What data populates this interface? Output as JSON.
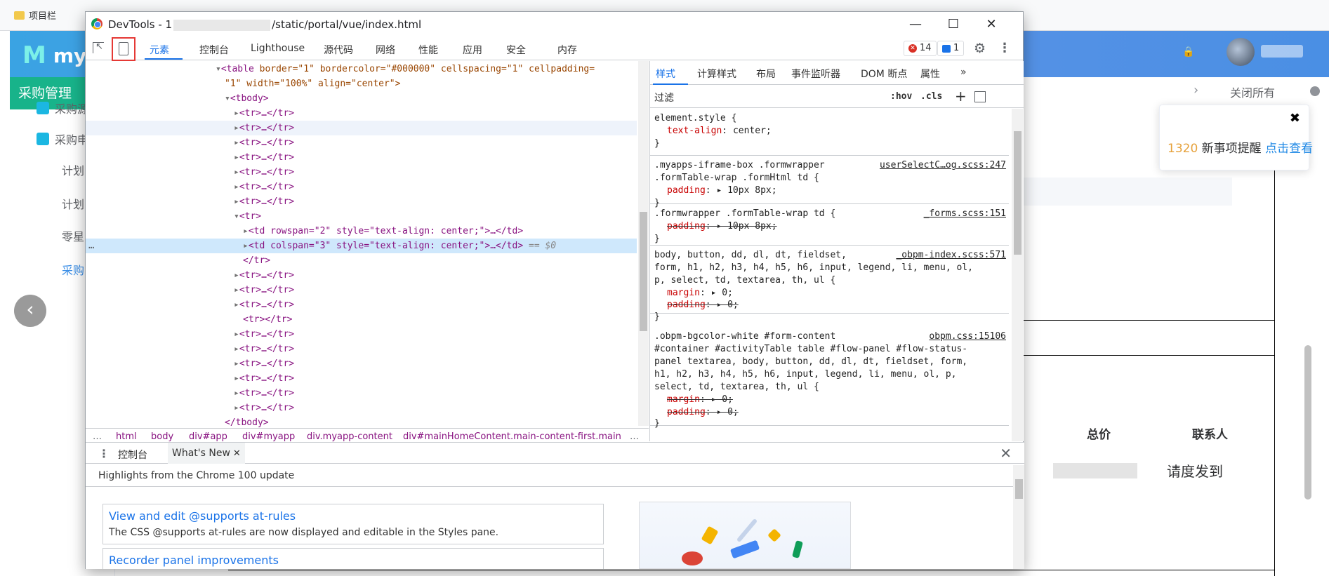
{
  "bookmarks": {
    "item": "项目栏"
  },
  "app": {
    "logo_text": "myA",
    "sidebar_title": "采购管理",
    "sidebar_items": [
      "采购源",
      "采购申"
    ],
    "sidebar_subitems": [
      "计划",
      "计划",
      "零星",
      "采购"
    ],
    "close_all": "关闭所有",
    "notification": {
      "count": "1320",
      "text": "新事项提醒",
      "link": "点击查看"
    },
    "table_headers": {
      "total": "总价",
      "contact": "联系人"
    },
    "cell_text": "请度发到"
  },
  "devtools": {
    "title_prefix": "DevTools - 1",
    "title_suffix": "/static/portal/vue/index.html",
    "window_buttons": {
      "minimize": "—",
      "maximize": "☐",
      "close": "✕"
    },
    "tabs": [
      "元素",
      "控制台",
      "Lighthouse",
      "源代码",
      "网络",
      "性能",
      "应用",
      "安全",
      "内存"
    ],
    "errors_count": "14",
    "issues_count": "1",
    "dom": {
      "table_open": "<table",
      "table_attrs_1": " border=\"1\" bordercolor=\"#000000\" cellspacing=\"1\" cellpadding=",
      "table_attrs_2": "\"1\" width=\"100%\" align=\"center\">",
      "tbody": "<tbody>",
      "tr_collapsed": "<tr>…</tr>",
      "tr_open": "<tr>",
      "td_rowspan": "<td rowspan=\"2\" style=\"text-align: center;\">…</td>",
      "td_colspan": "<td colspan=\"3\" style=\"text-align: center;\">…</td>",
      "selected_marker": "== $0",
      "tr_close": "</tr>",
      "tr_empty": "<tr></tr>",
      "tbody_close": "</tbody>",
      "dots": "…"
    },
    "breadcrumb": [
      "…",
      "html",
      "body",
      "div#app",
      "div#myapp",
      "div.myapp-content",
      "div#mainHomeContent.main-content-first.main-cor",
      "…"
    ],
    "styles_tabs": [
      "样式",
      "计算样式",
      "布局",
      "事件监听器",
      "DOM 断点",
      "属性",
      "»"
    ],
    "filter_placeholder": "过滤",
    "hov": ":hov",
    "cls": ".cls",
    "plus": "+",
    "rules": [
      {
        "selector": "element.style {",
        "source": "",
        "props": [
          {
            "name": "text-align",
            "value": "center;",
            "struck": false
          }
        ]
      },
      {
        "selector": ".myapps-iframe-box .formwrapper",
        "selector2": ".formTable-wrap .formHtml td {",
        "source": "userSelectC…og.scss:247",
        "props": [
          {
            "name": "padding",
            "value": "▸ 10px 8px;",
            "struck": false
          }
        ]
      },
      {
        "selector": ".formwrapper .formTable-wrap td {",
        "source": "_forms.scss:151",
        "props": [
          {
            "name": "padding",
            "value": "▸ 10px 8px;",
            "struck": true
          }
        ]
      },
      {
        "selector": "body, button, dd, dl, dt, fieldset,",
        "selector2": "form, h1, h2, h3, h4, h5, h6, input, legend, li, menu, ol,",
        "selector3": "p, select, td, textarea, th, ul {",
        "source": "_obpm-index.scss:571",
        "props": [
          {
            "name": "margin",
            "value": "▸ 0;",
            "struck": false
          },
          {
            "name": "padding",
            "value": "▸ 0;",
            "struck": true
          }
        ]
      },
      {
        "selector": ".obpm-bgcolor-white #form-content",
        "selector2": "#container #activityTable table #flow-panel #flow-status-",
        "selector3": "panel textarea, body, button, dd, dl, dt, fieldset, form,",
        "selector4": "h1, h2, h3, h4, h5, h6, input, legend, li, menu, ol, p,",
        "selector5": "select, td, textarea, th, ul {",
        "source": "obpm.css:15106",
        "props": [
          {
            "name": "margin",
            "value": "▸ 0;",
            "struck": true
          },
          {
            "name": "padding",
            "value": "▸ 0;",
            "struck": true
          }
        ]
      }
    ],
    "close_brace": "}",
    "drawer": {
      "tab_console": "控制台",
      "tab_whatsnew": "What's New",
      "tab_close": "✕",
      "subtitle": "Highlights from the Chrome 100 update",
      "card1_title": "View and edit @supports at-rules",
      "card1_desc": "The CSS @supports at-rules are now displayed and editable in the Styles pane.",
      "card2_title": "Recorder panel improvements"
    }
  }
}
